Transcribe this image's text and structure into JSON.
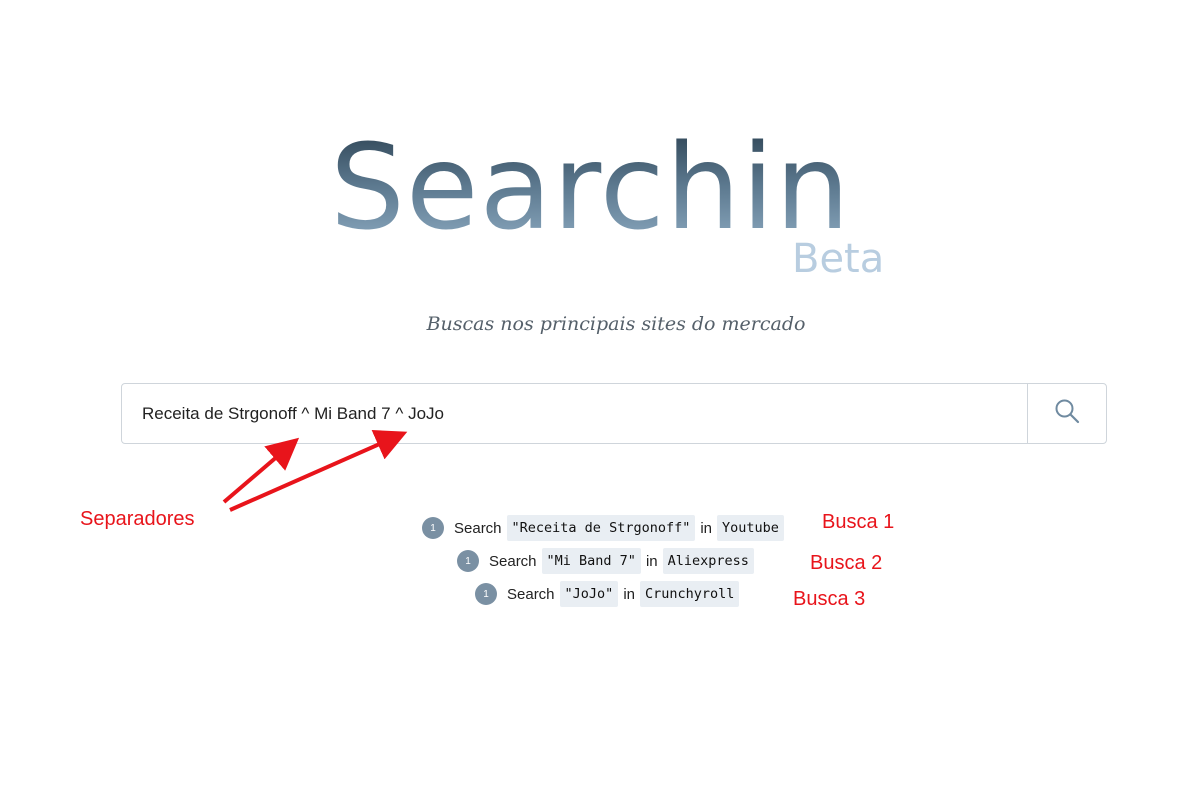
{
  "logo": {
    "title": "Searchin",
    "badge": "Beta"
  },
  "subtitle": "Buscas nos principais sites do mercado",
  "search": {
    "value": "Receita de Strgonoff ^ Mi Band 7 ^ JoJo",
    "button_icon": "search-icon"
  },
  "annotations": {
    "separadores": "Separadores",
    "busca1": "Busca 1",
    "busca2": "Busca 2",
    "busca3": "Busca 3",
    "color": "#e8141b"
  },
  "results": [
    {
      "badge": "1",
      "search_word": "Search",
      "query": "\"Receita de Strgonoff\"",
      "in_word": "in",
      "site": "Youtube"
    },
    {
      "badge": "1",
      "search_word": "Search",
      "query": "\"Mi Band 7\"",
      "in_word": "in",
      "site": "Aliexpress"
    },
    {
      "badge": "1",
      "search_word": "Search",
      "query": "\"JoJo\"",
      "in_word": "in",
      "site": "Crunchyroll"
    }
  ]
}
